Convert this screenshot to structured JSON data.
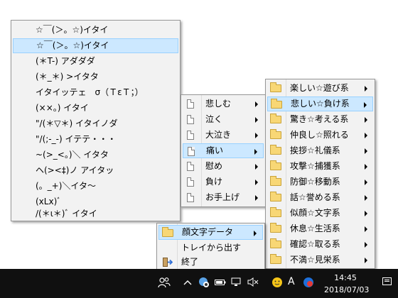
{
  "emoticon_menu": {
    "items": [
      {
        "label": "☆￣(＞。☆)イタイ",
        "highlighted": false
      },
      {
        "label": "☆￣(＞。☆)イタイ",
        "highlighted": true
      },
      {
        "label": "(＊T-) アダダダ",
        "highlighted": false
      },
      {
        "label": "(＊_＊) >イタタ",
        "highlighted": false
      },
      {
        "label": "イタイッテェ　σ（ＴεＴ；）",
        "highlighted": false
      },
      {
        "label": "(××。) イタイ",
        "highlighted": false
      },
      {
        "label": "\"/(＊▽＊) イタイノダ",
        "highlighted": false
      },
      {
        "label": "\"/(;-_-) イテテ・・・",
        "highlighted": false
      },
      {
        "label": "~(>_<。)＼ イタタ",
        "highlighted": false
      },
      {
        "label": "ヘ(><‡)ノ アイタッ",
        "highlighted": false
      },
      {
        "label": "(。_+)＼イタ〜",
        "highlighted": false
      },
      {
        "label": "(xLx)ﾞ",
        "highlighted": false
      },
      {
        "label": "/(＊ι＊)ﾞ イタイ",
        "highlighted": false
      }
    ]
  },
  "sub_menu": {
    "items": [
      {
        "label": "悲しむ",
        "icon": "document-icon",
        "highlighted": false
      },
      {
        "label": "泣く",
        "icon": "document-icon",
        "highlighted": false
      },
      {
        "label": "大泣き",
        "icon": "document-icon",
        "highlighted": false
      },
      {
        "label": "痛い",
        "icon": "document-icon",
        "highlighted": true
      },
      {
        "label": "慰め",
        "icon": "document-icon",
        "highlighted": false
      },
      {
        "label": "負け",
        "icon": "document-icon",
        "highlighted": false
      },
      {
        "label": "お手上げ",
        "icon": "document-icon",
        "highlighted": false
      }
    ]
  },
  "category_menu": {
    "items": [
      {
        "label": "楽しい☆遊び系",
        "icon": "folder-icon",
        "highlighted": false
      },
      {
        "label": "悲しい☆負け系",
        "icon": "folder-icon",
        "highlighted": true
      },
      {
        "label": "驚き☆考える系",
        "icon": "folder-icon",
        "highlighted": false
      },
      {
        "label": "仲良し☆照れる",
        "icon": "folder-icon",
        "highlighted": false
      },
      {
        "label": "挨拶☆礼儀系",
        "icon": "folder-icon",
        "highlighted": false
      },
      {
        "label": "攻撃☆捕獲系",
        "icon": "folder-icon",
        "highlighted": false
      },
      {
        "label": "防御☆移動系",
        "icon": "folder-icon",
        "highlighted": false
      },
      {
        "label": "話☆誉める系",
        "icon": "folder-icon",
        "highlighted": false
      },
      {
        "label": "似顔☆文字系",
        "icon": "folder-icon",
        "highlighted": false
      },
      {
        "label": "休息☆生活系",
        "icon": "folder-icon",
        "highlighted": false
      },
      {
        "label": "確認☆取る系",
        "icon": "folder-icon",
        "highlighted": false
      },
      {
        "label": "不満☆見栄系",
        "icon": "folder-icon",
        "highlighted": false
      }
    ]
  },
  "tray_menu": {
    "items": [
      {
        "label": "顔文字データ",
        "icon": "folder-icon",
        "highlighted": true
      },
      {
        "label": "トレイから出す",
        "icon": "",
        "highlighted": false
      },
      {
        "label": "終了",
        "icon": "exit-icon",
        "highlighted": false
      }
    ]
  },
  "taskbar": {
    "time": "14:45",
    "date": "2018/07/03",
    "ime_label": "A"
  },
  "colors": {
    "highlight": "#cce8ff",
    "highlight_border": "#99d1ff",
    "menu_bg": "#f2f2f2",
    "taskbar_bg": "#101010"
  }
}
